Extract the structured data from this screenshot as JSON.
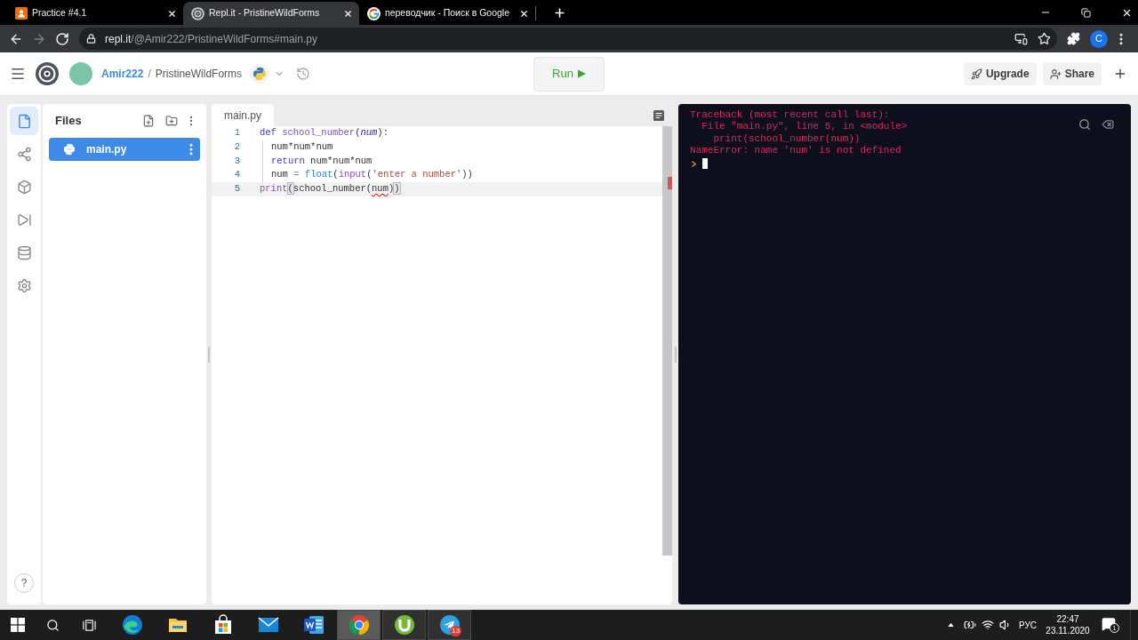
{
  "browser": {
    "tabs": [
      {
        "kind": "slides",
        "title": "Practice #4.1",
        "selected": false
      },
      {
        "kind": "replit",
        "title": "Repl.it - PristineWildForms",
        "selected": true
      },
      {
        "kind": "google",
        "title": "переводчик - Поиск в Google",
        "selected": false
      }
    ],
    "nav": [
      {
        "kind": "back",
        "disabled": false
      },
      {
        "kind": "forward",
        "disabled": true
      },
      {
        "kind": "reload",
        "disabled": false
      }
    ],
    "address": {
      "host": "repl.it",
      "path": "/@Amir222/PristineWildForms#main.py"
    },
    "profile": "C"
  },
  "header": {
    "user": "Amir222",
    "separator": "/",
    "repl": "PristineWildForms",
    "run": "Run",
    "actions": [
      {
        "kind": "upgrade",
        "label": "Upgrade"
      },
      {
        "kind": "share",
        "label": "Share"
      }
    ]
  },
  "rail": [
    {
      "kind": "files",
      "selected": true
    },
    {
      "kind": "version_control",
      "selected": false
    },
    {
      "kind": "packages",
      "selected": false
    },
    {
      "kind": "debugger",
      "selected": false
    },
    {
      "kind": "database",
      "selected": false
    },
    {
      "kind": "settings",
      "selected": false
    }
  ],
  "help": "?",
  "files": {
    "title": "Files",
    "items": [
      {
        "name": "main.py",
        "selected": true
      }
    ]
  },
  "editor": {
    "tabs": [
      {
        "label": "main.py",
        "selected": true
      }
    ],
    "lines": [
      {
        "number": "1",
        "active": false,
        "tokens": [
          {
            "kind": "keyword",
            "text": "def "
          },
          {
            "kind": "function",
            "text": "school_number"
          },
          {
            "kind": "plain",
            "text": "("
          },
          {
            "kind": "param",
            "text": "num"
          },
          {
            "kind": "plain",
            "text": "):"
          }
        ],
        "children": [
          {
            "number": "2",
            "active": false,
            "tokens": [
              {
                "kind": "plain",
                "text": "num*num*num"
              }
            ]
          },
          {
            "number": "3",
            "active": false,
            "tokens": [
              {
                "kind": "keyword",
                "text": "return"
              },
              {
                "kind": "plain",
                "text": " num*num*num"
              }
            ]
          },
          {
            "number": "4",
            "active": false,
            "tokens": [
              {
                "kind": "plain",
                "text": "num "
              },
              {
                "kind": "operator",
                "text": "= "
              },
              {
                "kind": "builtin",
                "text": "float"
              },
              {
                "kind": "plain",
                "text": "("
              },
              {
                "kind": "call",
                "text": "input"
              },
              {
                "kind": "plain",
                "text": "("
              },
              {
                "kind": "string",
                "text": "'enter a number'"
              },
              {
                "kind": "plain",
                "text": "))"
              }
            ]
          }
        ]
      },
      {
        "number": "5",
        "active": true,
        "tokens": [
          {
            "kind": "call",
            "text": "print"
          },
          {
            "kind": "bracket",
            "text": "("
          },
          {
            "kind": "plain",
            "text": "school_number("
          },
          {
            "kind": "error",
            "text": "num"
          },
          {
            "kind": "plain",
            "text": ")"
          },
          {
            "kind": "bracket",
            "text": ")"
          }
        ]
      }
    ]
  },
  "console": {
    "lines": [
      "Traceback (most recent call last):",
      "  File \"main.py\", line 5, in <module>",
      "    print(school_number(num))",
      "NameError: name 'num' is not defined"
    ]
  },
  "taskbar": {
    "system": [
      {
        "kind": "start"
      },
      {
        "kind": "search"
      },
      {
        "kind": "task_view"
      }
    ],
    "apps": [
      {
        "kind": "edge",
        "selected": false,
        "open": false
      },
      {
        "kind": "explorer",
        "selected": false,
        "open": false
      },
      {
        "kind": "store",
        "selected": false,
        "open": false
      },
      {
        "kind": "mail",
        "selected": false,
        "open": false
      },
      {
        "kind": "word",
        "selected": false,
        "open": false
      },
      {
        "kind": "chrome",
        "selected": true,
        "open": true
      },
      {
        "kind": "utorrent",
        "selected": false,
        "open": true
      },
      {
        "kind": "telegram",
        "selected": false,
        "open": true,
        "badge": "13"
      }
    ],
    "tray": [
      {
        "kind": "overflow"
      },
      {
        "kind": "battery"
      },
      {
        "kind": "wifi"
      },
      {
        "kind": "volume"
      }
    ],
    "language": "РУС",
    "time": "22:47",
    "date": "23.11.2020",
    "notifications": "1"
  }
}
